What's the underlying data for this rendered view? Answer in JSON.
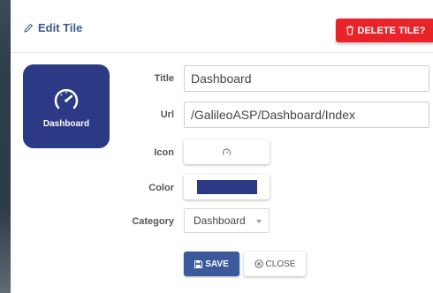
{
  "header": {
    "title": "Edit Tile",
    "delete_label": "DELETE TILE?"
  },
  "tile": {
    "label": "Dashboard",
    "background": "#2c3a86",
    "icon": "speedometer-icon"
  },
  "form": {
    "title_label": "Title",
    "title_value": "Dashboard",
    "url_label": "Url",
    "url_value": "/GalileoASP/Dashboard/Index",
    "icon_label": "Icon",
    "icon_value": "speedometer-icon",
    "color_label": "Color",
    "color_value": "#2c3a86",
    "category_label": "Category",
    "category_value": "Dashboard"
  },
  "actions": {
    "save_label": "SAVE",
    "close_label": "CLOSE"
  },
  "colors": {
    "primary": "#3a5a9c",
    "danger": "#e8232a"
  }
}
